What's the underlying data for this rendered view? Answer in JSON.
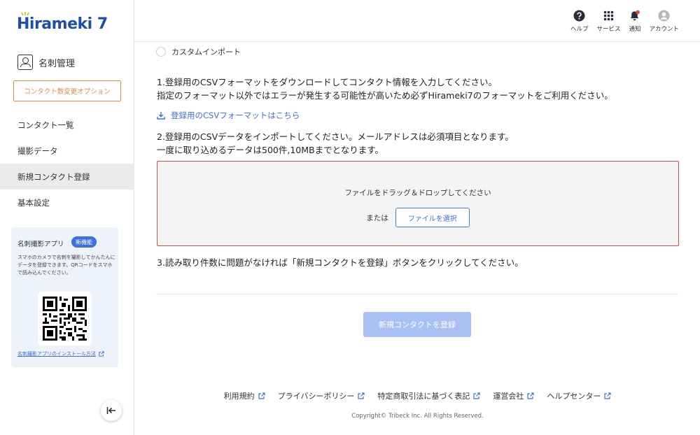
{
  "brand": {
    "name": "Hirameki 7",
    "color": "#1d4fa8"
  },
  "sidebar": {
    "module_label": "名刺管理",
    "option_button": "コンタクト数変更オプション",
    "items": [
      {
        "label": "コンタクト一覧",
        "active": false
      },
      {
        "label": "撮影データ",
        "active": false
      },
      {
        "label": "新規コンタクト登録",
        "active": true
      },
      {
        "label": "基本設定",
        "active": false
      }
    ],
    "promo": {
      "title": "名刺撮影アプリ",
      "badge": "新機能",
      "description": "スマホのカメラで名刺を撮影してかんたんにデータを登録できます。QRコードをスマホで読み込んでください。",
      "link": "名刺撮影アプリのインストール方法"
    }
  },
  "header": {
    "actions": [
      {
        "label": "ヘルプ",
        "icon": "help-icon"
      },
      {
        "label": "サービス",
        "icon": "grid-icon"
      },
      {
        "label": "通知",
        "icon": "bell-icon"
      },
      {
        "label": "アカウント",
        "icon": "account-icon"
      }
    ]
  },
  "main": {
    "radio_label": "カスタムインポート",
    "step1_line1": "1.登録用のCSVフォーマットをダウンロードしてコンタクト情報を入力してください。",
    "step1_line2": "指定のフォーマット以外ではエラーが発生する可能性が高いため必ずHirameki7のフォーマットをご利用ください。",
    "download_link": "登録用のCSVフォーマットはこちら",
    "step2_line1": "2.登録用のCSVデータをインポートしてください。メールアドレスは必須項目となります。",
    "step2_line2": "一度に取り込めるデータは500件,10MBまでとなります。",
    "dropzone_text": "ファイルをドラッグ＆ドロップしてください",
    "or_text": "または",
    "file_button": "ファイルを選択",
    "step3": "3.読み取り件数に問題がなければ「新規コンタクトを登録」ボタンをクリックしてください。",
    "submit_button": "新規コンタクトを登録"
  },
  "footer": {
    "links": [
      "利用規約",
      "プライバシーポリシー",
      "特定商取引法に基づく表記",
      "運営会社",
      "ヘルプセンター"
    ],
    "copyright": "Copyright© Tribeck Inc. All Rights Reserved."
  },
  "colors": {
    "accent": "#3f6fe0",
    "warning": "#f08a3c",
    "error_border": "#d94a4a",
    "submit_disabled": "#a9c0f5"
  }
}
